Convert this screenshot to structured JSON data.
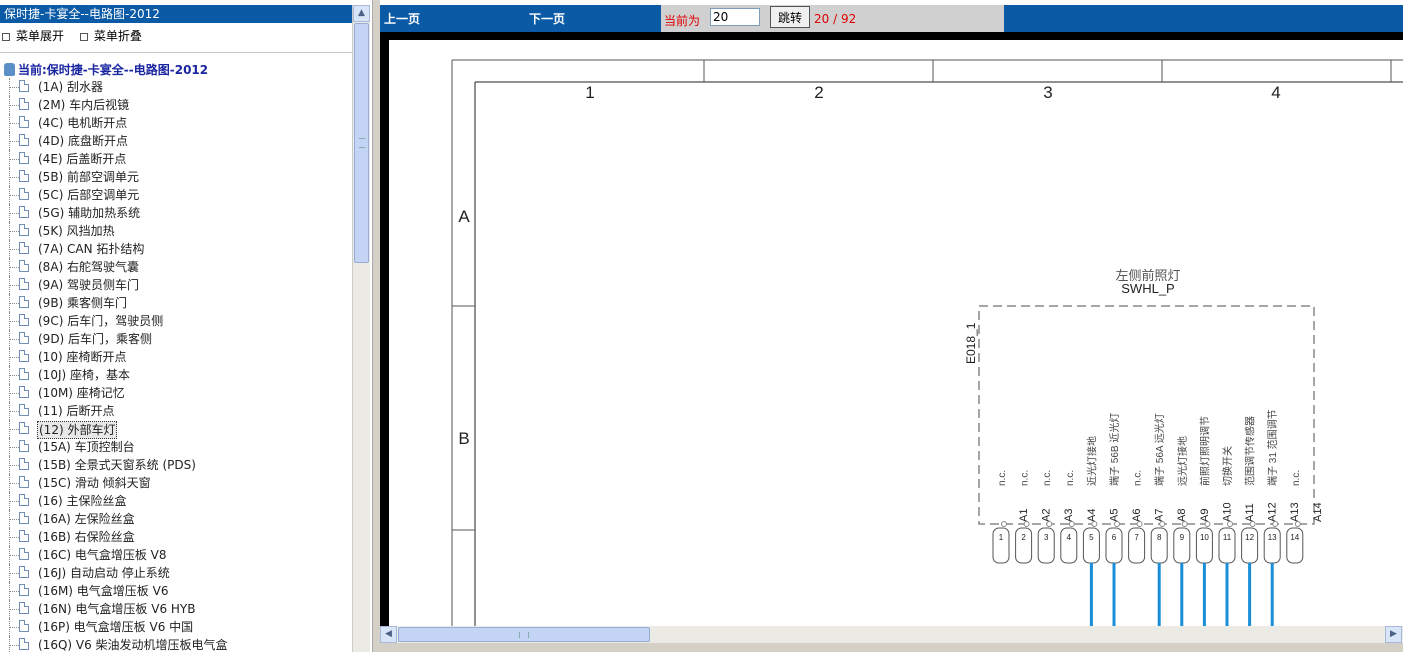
{
  "sidebar": {
    "title": "保时捷-卡宴全--电路图-2012",
    "expand_label": "菜单展开",
    "collapse_label": "菜单折叠",
    "current_label": "当前:保时捷-卡宴全--电路图-2012",
    "items": [
      {
        "label": "(1A) 刮水器"
      },
      {
        "label": "(2M) 车内后视镜"
      },
      {
        "label": "(4C) 电机断开点"
      },
      {
        "label": "(4D) 底盘断开点"
      },
      {
        "label": "(4E) 后盖断开点"
      },
      {
        "label": "(5B) 前部空调单元"
      },
      {
        "label": "(5C) 后部空调单元"
      },
      {
        "label": "(5G) 辅助加热系统"
      },
      {
        "label": "(5K) 风挡加热"
      },
      {
        "label": "(7A) CAN 拓扑结构"
      },
      {
        "label": "(8A) 右舵驾驶气囊"
      },
      {
        "label": "(9A) 驾驶员侧车门"
      },
      {
        "label": "(9B) 乘客侧车门"
      },
      {
        "label": "(9C) 后车门，驾驶员侧"
      },
      {
        "label": "(9D) 后车门，乘客侧"
      },
      {
        "label": "(10) 座椅断开点"
      },
      {
        "label": "(10J) 座椅，基本"
      },
      {
        "label": "(10M) 座椅记忆"
      },
      {
        "label": "(11) 后断开点"
      },
      {
        "label": "(12) 外部车灯",
        "selected": true
      },
      {
        "label": "(15A) 车顶控制台"
      },
      {
        "label": "(15B) 全景式天窗系统 (PDS)"
      },
      {
        "label": "(15C) 滑动 倾斜天窗"
      },
      {
        "label": "(16) 主保险丝盒"
      },
      {
        "label": "(16A) 左保险丝盒"
      },
      {
        "label": "(16B) 右保险丝盒"
      },
      {
        "label": "(16C) 电气盒增压板  V8"
      },
      {
        "label": "(16J) 自动启动 停止系统"
      },
      {
        "label": "(16M) 电气盒增压板  V6"
      },
      {
        "label": "(16N) 电气盒增压板  V6 HYB"
      },
      {
        "label": "(16P) 电气盒增压板  V6 中国"
      },
      {
        "label": "(16Q) V6 柴油发动机增压板电气盒"
      }
    ]
  },
  "toolbar": {
    "prev_label": "上一页",
    "next_label": "下一页",
    "current_label": "当前为",
    "page_value": "20",
    "go_label": "跳转",
    "page_count": "20 / 92"
  },
  "diagram": {
    "columns": [
      "1",
      "2",
      "3",
      "4"
    ],
    "rows": [
      "A",
      "B"
    ],
    "component_name": "左侧前照灯",
    "component_code": "SWHL_P",
    "connector_id": "E018_1",
    "pin_labels": [
      "n.c.",
      "n.c.",
      "n.c.",
      "n.c.",
      "近光灯接地",
      "端子 56B 近光灯",
      "n.c.",
      "端子 56A 远光灯",
      "远光灯接地",
      "前照灯照明调节",
      "切换开关",
      "范围调节传感器",
      "端子 31 范围调节",
      "n.c."
    ],
    "pins": [
      "A1",
      "A2",
      "A3",
      "A4",
      "A5",
      "A6",
      "A7",
      "A8",
      "A9",
      "A10",
      "A11",
      "A12",
      "A13",
      "A14"
    ],
    "terminals": [
      "1",
      "2",
      "3",
      "4",
      "5",
      "6",
      "7",
      "8",
      "9",
      "10",
      "11",
      "12",
      "13",
      "14"
    ],
    "wire_color": "#1a8fd8"
  }
}
